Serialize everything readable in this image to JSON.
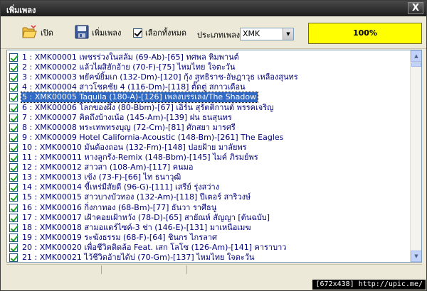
{
  "window": {
    "title": "เพิ่มเพลง",
    "close_label": "X"
  },
  "toolbar": {
    "open_label": "เปิด",
    "add_label": "เพิ่มเพลง",
    "select_all_label": "เลือกทั้งหมด",
    "select_all_checked": true,
    "type_label": "ประเภทเพลง",
    "type_value": "XMK",
    "progress_text": "100%",
    "progress_value": 1.0
  },
  "songs": [
    {
      "text": "1 : XMK00001 เพชรร่วงในสลัม (69-Ab)-[65] ทศพล หิมพานต์",
      "checked": true,
      "selected": false
    },
    {
      "text": "2 : XMK00002 แล้วไผสิฮักอ้าย (70-F)-[75] ไหมไทย ใจตะวัน",
      "checked": true,
      "selected": false
    },
    {
      "text": "3 : XMK00003 พยัคฆ์ยิ้มเก (132-Dm)-[120] กุ้ง สุทธิราช-อัษฎาวุธ เหลืองสุนทร",
      "checked": true,
      "selected": false
    },
    {
      "text": "4 : XMK00004 สาวโชคชัย 4 (116-Dm)-[118] ตั๊ดตู่ สกาวเดือน",
      "checked": true,
      "selected": false
    },
    {
      "text": "5 : XMK00005 Taquila (180-A)-[126] เพลงบรรเลง/The Shadow",
      "checked": true,
      "selected": true
    },
    {
      "text": "6 : XMK00006 โลกของผึ้ง (80-Bbm)-[67] เอิร์น สุรัตติกานต์ พรรคเจริญ",
      "checked": true,
      "selected": false
    },
    {
      "text": "7 : XMK00007 คิดถึงบ้างเน้อ (145-Am)-[139] ฝน ธนสุนทร",
      "checked": true,
      "selected": false
    },
    {
      "text": "8 : XMK00008 พระเทพทรงบุญ (72-Cm)-[81] ศักสยา มารศรี",
      "checked": true,
      "selected": false
    },
    {
      "text": "9 : XMK00009 Hotel California-Acoustic (148-Bm)-[261] The Eagles",
      "checked": true,
      "selected": false
    },
    {
      "text": "10 : XMK00010 มันต้องถอน (132-Fm)-[148] ปอยฝ้าย มาลัยพร",
      "checked": true,
      "selected": false
    },
    {
      "text": "11 : XMK00011 หางลูกรัง-Remix (148-Bbm)-[145] ไมค์ ภิรมย์พร",
      "checked": true,
      "selected": false
    },
    {
      "text": "12 : XMK00012 สาวสา (108-Am)-[117] คนมอ",
      "checked": true,
      "selected": false
    },
    {
      "text": "13 : XMK00013 เข้ง  (73-F)-[66] ไท ธนาวุฒิ",
      "checked": true,
      "selected": false
    },
    {
      "text": "14 : XMK00014 ขี้เหร่มีสัยดี (96-G)-[111] เสรีย์ รุ่งสว่าง",
      "checked": true,
      "selected": false
    },
    {
      "text": "15 : XMK00015 สาวบางบัวทอง (132-Am)-[118] ปีเตอร์ สาริวงษ์",
      "checked": true,
      "selected": false
    },
    {
      "text": "16 : XMK00016 กิ่งกาทอง (68-Bm)-[77] ธันวา ราศีธนู",
      "checked": true,
      "selected": false
    },
    {
      "text": "17 : XMK00017 เฝ้าคอยเฝ้าหวัง (78-D)-[65] สายัณห์ สัญญา [ต้นฉบับ]",
      "checked": true,
      "selected": false
    },
    {
      "text": "18 : XMK00018 สามอแดร์ไซค์-3 ช่า (146-E)-[131] มาเหนือเมฆ",
      "checked": true,
      "selected": false
    },
    {
      "text": "19 : XMK00019 ระฆังธรรม  (68-F)-[64] ชินกร  ไกรลาศ",
      "checked": true,
      "selected": false
    },
    {
      "text": "20 : XMK00020 เพื่อชีวิตติดล้อ Feat. เสก โลโซ (126-Am)-[141] คาราบาว",
      "checked": true,
      "selected": false
    },
    {
      "text": "21 : XMK00021 ไว้ชีวิตอ้ายได้บ่ (70-Gm)-[137] ไหมไทย ใจตะวัน",
      "checked": true,
      "selected": false
    }
  ],
  "watermark": "[672x438] http://upic.me/"
}
